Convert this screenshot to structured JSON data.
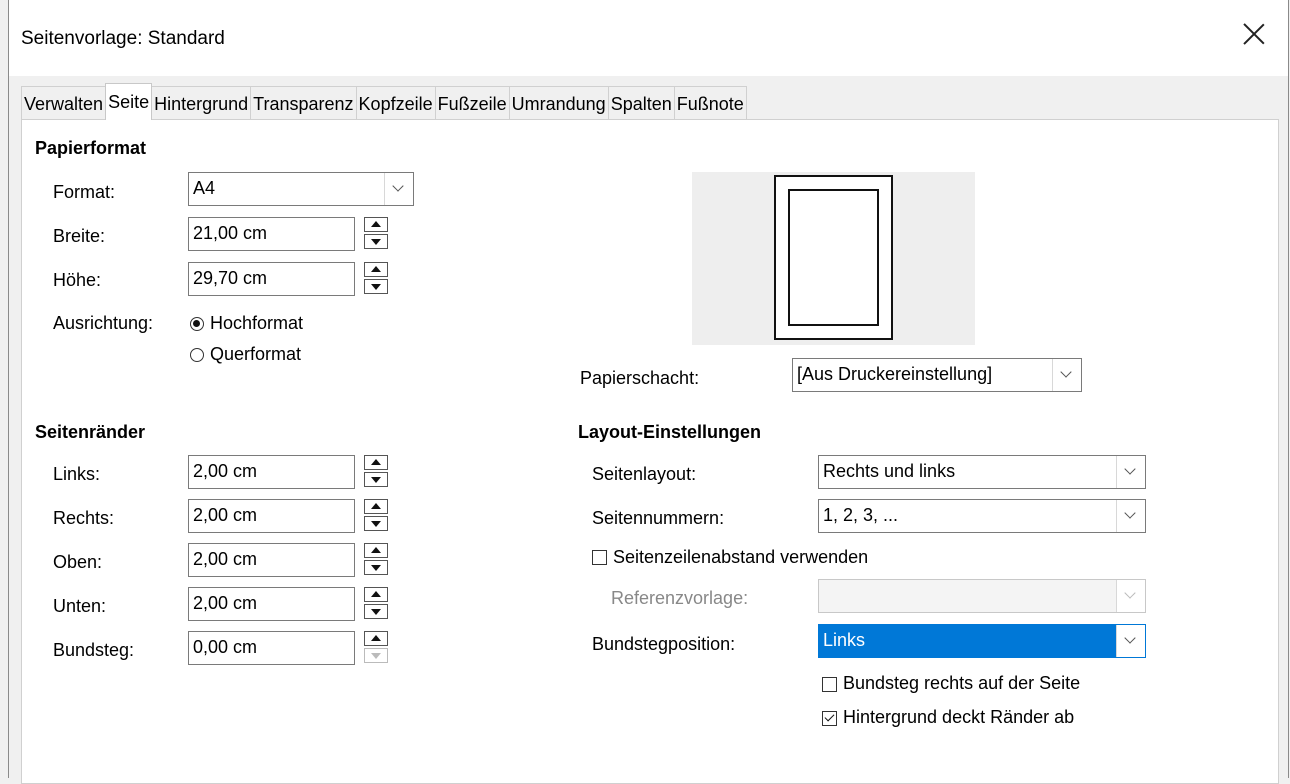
{
  "window": {
    "title": "Seitenvorlage: Standard"
  },
  "tabs": [
    "Verwalten",
    "Seite",
    "Hintergrund",
    "Transparenz",
    "Kopfzeile",
    "Fußzeile",
    "Umrandung",
    "Spalten",
    "Fußnote"
  ],
  "active_tab": "Seite",
  "papierformat": {
    "heading": "Papierformat",
    "format_label": "Format:",
    "format_value": "A4",
    "breite_label": "Breite:",
    "breite_value": "21,00 cm",
    "hoehe_label": "Höhe:",
    "hoehe_value": "29,70 cm",
    "ausrichtung_label": "Ausrichtung:",
    "hochformat_label": "Hochformat",
    "querformat_label": "Querformat",
    "orientation_selected": "Hochformat"
  },
  "papierschacht": {
    "label": "Papierschacht:",
    "value": "[Aus Druckereinstellung]"
  },
  "seitenraender": {
    "heading": "Seitenränder",
    "links_label": "Links:",
    "links_value": "2,00 cm",
    "rechts_label": "Rechts:",
    "rechts_value": "2,00 cm",
    "oben_label": "Oben:",
    "oben_value": "2,00 cm",
    "unten_label": "Unten:",
    "unten_value": "2,00 cm",
    "bundsteg_label": "Bundsteg:",
    "bundsteg_value": "0,00 cm"
  },
  "layout": {
    "heading": "Layout-Einstellungen",
    "seitenlayout_label": "Seitenlayout:",
    "seitenlayout_value": "Rechts und links",
    "seitennummern_label": "Seitennummern:",
    "seitennummern_value": "1, 2, 3, ...",
    "zeilenabstand_label": "Seitenzeilenabstand verwenden",
    "zeilenabstand_checked": false,
    "referenz_label": "Referenzvorlage:",
    "referenz_value": "",
    "bundstegposition_label": "Bundstegposition:",
    "bundstegposition_value": "Links",
    "bundsteg_rechts_label": "Bundsteg rechts auf der Seite",
    "bundsteg_rechts_checked": false,
    "hintergrund_label": "Hintergrund deckt Ränder ab",
    "hintergrund_checked": true
  }
}
